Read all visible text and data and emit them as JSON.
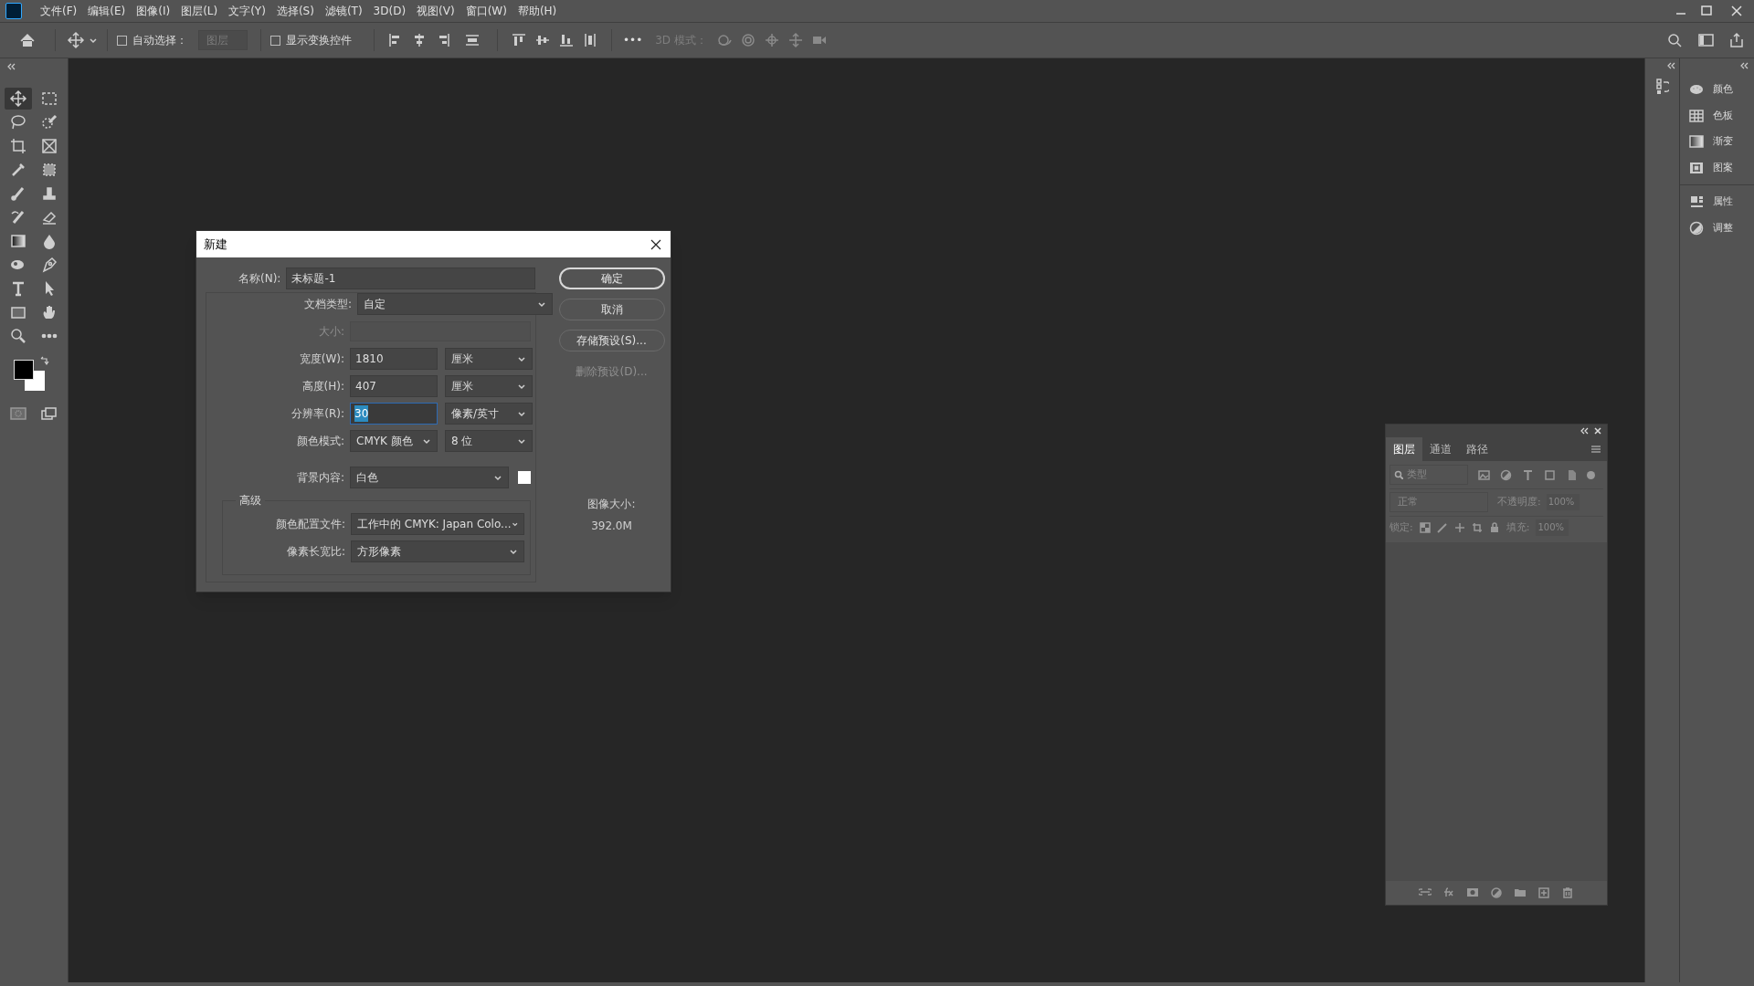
{
  "menu_bar": {
    "items": [
      "文件(F)",
      "编辑(E)",
      "图像(I)",
      "图层(L)",
      "文字(Y)",
      "选择(S)",
      "滤镜(T)",
      "3D(D)",
      "视图(V)",
      "窗口(W)",
      "帮助(H)"
    ]
  },
  "options_bar": {
    "auto_select": {
      "label": "自动选择：",
      "checked": false
    },
    "layer_select": {
      "value": "图层"
    },
    "show_transform": {
      "label": "显示变换控件",
      "checked": false
    },
    "more": "•••",
    "mode_3d": "3D 模式："
  },
  "tools": [
    {
      "kind": "move",
      "selected": true
    },
    {
      "kind": "marquee",
      "selected": false
    },
    {
      "kind": "lasso",
      "selected": false
    },
    {
      "kind": "quick-select",
      "selected": false
    },
    {
      "kind": "crop",
      "selected": false
    },
    {
      "kind": "frame",
      "selected": false
    },
    {
      "kind": "eyedropper",
      "selected": false
    },
    {
      "kind": "patch",
      "selected": false
    },
    {
      "kind": "brush",
      "selected": false
    },
    {
      "kind": "stamp",
      "selected": false
    },
    {
      "kind": "history-brush",
      "selected": false
    },
    {
      "kind": "eraser",
      "selected": false
    },
    {
      "kind": "gradient",
      "selected": false
    },
    {
      "kind": "drop",
      "selected": false
    },
    {
      "kind": "dodge",
      "selected": false
    },
    {
      "kind": "pen",
      "selected": false
    },
    {
      "kind": "type",
      "selected": false
    },
    {
      "kind": "pointer",
      "selected": false
    },
    {
      "kind": "rectangle",
      "selected": false
    },
    {
      "kind": "hand",
      "selected": false
    },
    {
      "kind": "zoom",
      "selected": false
    },
    {
      "kind": "more",
      "selected": false
    }
  ],
  "dialog": {
    "title": "新建",
    "name": {
      "label": "名称(N):",
      "value": "未标题-1"
    },
    "document_type": {
      "label": "文档类型:",
      "value": "自定"
    },
    "size": {
      "label": "大小:",
      "disabled": true
    },
    "width": {
      "label": "宽度(W):",
      "value": "1810",
      "unit": "厘米"
    },
    "height": {
      "label": "高度(H):",
      "value": "407",
      "unit": "厘米"
    },
    "resolution": {
      "label": "分辨率(R):",
      "value": "30",
      "unit": "像素/英寸",
      "focused": true
    },
    "color_mode": {
      "label": "颜色模式:",
      "value": "CMYK 颜色",
      "depth": "8 位"
    },
    "background": {
      "label": "背景内容:",
      "value": "白色"
    },
    "advanced": {
      "title": "高级",
      "profile": {
        "label": "颜色配置文件:",
        "value": "工作中的 CMYK: Japan Colo..."
      },
      "pixel_aspect": {
        "label": "像素长宽比:",
        "value": "方形像素"
      }
    },
    "buttons": [
      {
        "label": "确定",
        "kind": "default",
        "disabled": false
      },
      {
        "label": "取消",
        "kind": "normal",
        "disabled": false
      },
      {
        "label": "存储预设(S)...",
        "kind": "normal",
        "disabled": false
      },
      {
        "label": "删除预设(D)...",
        "kind": "normal",
        "disabled": true
      }
    ],
    "image_size": {
      "label": "图像大小:",
      "value": "392.0M"
    }
  },
  "panel_dock": {
    "groups": [
      {
        "items": [
          {
            "label": "颜色",
            "kind": "color"
          },
          {
            "label": "色板",
            "kind": "swatches"
          },
          {
            "label": "渐变",
            "kind": "gradient"
          },
          {
            "label": "图案",
            "kind": "pattern"
          }
        ]
      },
      {
        "items": [
          {
            "label": "属性",
            "kind": "properties"
          },
          {
            "label": "调整",
            "kind": "adjust"
          }
        ]
      }
    ]
  },
  "layers_panel": {
    "tabs": [
      {
        "label": "图层",
        "selected": true
      },
      {
        "label": "通道",
        "selected": false
      },
      {
        "label": "路径",
        "selected": false
      }
    ],
    "filter": {
      "placeholder": "类型"
    },
    "blend_mode": "正常",
    "opacity": {
      "label": "不透明度:",
      "value": "100%"
    },
    "lock": {
      "label": "锁定:"
    },
    "fill": {
      "label": "填充:",
      "value": "100%"
    }
  }
}
